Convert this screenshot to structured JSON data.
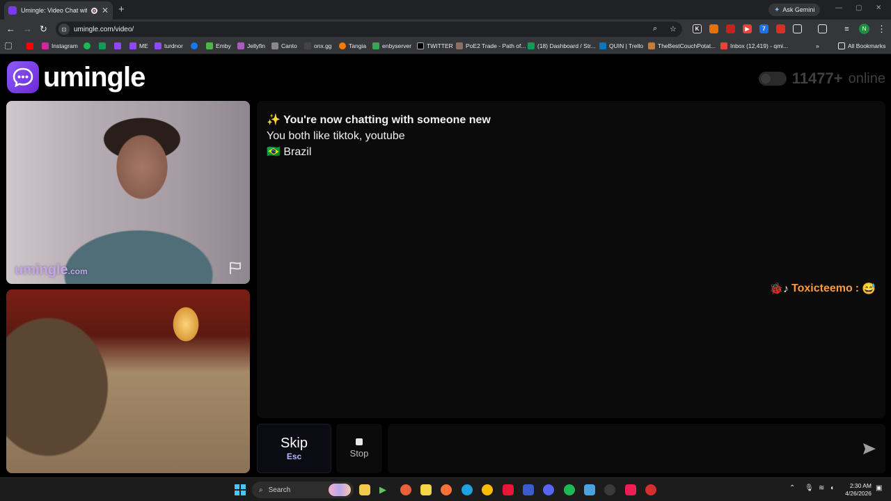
{
  "browser": {
    "tab_title": "Umingle: Video Chat with S",
    "new_tab": "+",
    "ask_gemini": "Ask Gemini",
    "url": "umingle.com/video/",
    "bookmarks": [
      "Instagram",
      "ME",
      "turdnor",
      "Emby",
      "Jellyfin",
      "Canto",
      "onx.gg",
      "Tangia",
      "enbyserver",
      "TWITTER",
      "PoE2 Trade - Path of...",
      "(18) Dashboard / Str...",
      "QUIN | Trello",
      "TheBestCouchPotat...",
      "Inbox (12,419) - qmi...",
      "All Bookmarks"
    ]
  },
  "header": {
    "logo_text": "umingle",
    "online_count": "11477+",
    "online_suffix": "online"
  },
  "video": {
    "watermark_main": "umingle",
    "watermark_tld": ".com"
  },
  "chat": {
    "headline": "✨ You're now chatting with someone new",
    "shared_interests": "You both like tiktok, youtube",
    "country_flag": "🇧🇷",
    "country": "Brazil",
    "message_badges": "🐞♪",
    "message_name": "Toxicteemo",
    "message_colon": ":",
    "message_emoji": "😅"
  },
  "controls": {
    "skip_label": "Skip",
    "skip_key": "Esc",
    "stop_label": "Stop",
    "message_value": ""
  },
  "taskbar": {
    "search_label": "Search",
    "time": "2:30 AM",
    "date": "4/26/2026"
  },
  "colors": {
    "brand_purple": "#7c3aed",
    "username_orange": "#ff9a3c",
    "watermark_lavender": "#c4a6e8"
  }
}
